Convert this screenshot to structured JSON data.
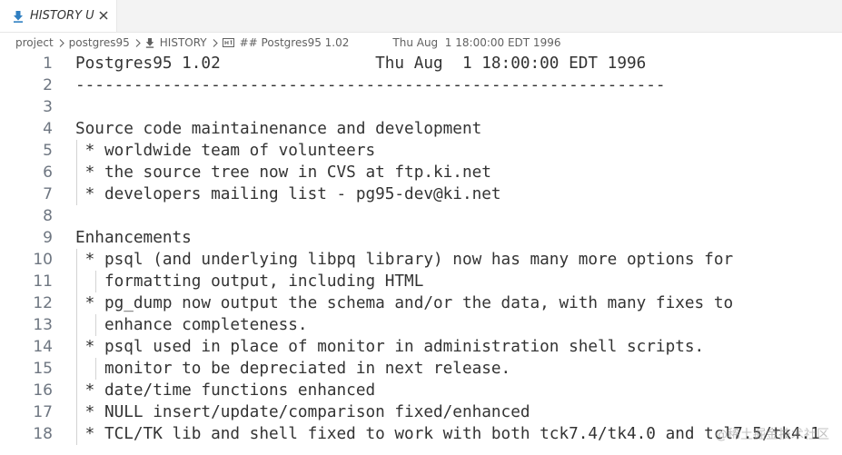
{
  "tab": {
    "label": "HISTORY U",
    "icon": "download-arrow-icon",
    "close_icon": "close-icon",
    "accent": "#2f7fc1"
  },
  "breadcrumb": {
    "items": [
      "project",
      "postgres95",
      "HISTORY",
      "## Postgres95 1.02"
    ],
    "trailing": "Thu Aug  1 18:00:00 EDT 1996"
  },
  "editor": {
    "line_numbers": [
      "1",
      "2",
      "3",
      "4",
      "5",
      "6",
      "7",
      "8",
      "9",
      "10",
      "11",
      "12",
      "13",
      "14",
      "15",
      "16",
      "17",
      "18"
    ],
    "lines": [
      "Postgres95 1.02                Thu Aug  1 18:00:00 EDT 1996",
      "-------------------------------------------------------------",
      "",
      "Source code maintainenance and development",
      " * worldwide team of volunteers",
      " * the source tree now in CVS at ftp.ki.net",
      " * developers mailing list - pg95-dev@ki.net",
      "",
      "Enhancements",
      " * psql (and underlying libpq library) now has many more options for",
      "   formatting output, including HTML",
      " * pg_dump now output the schema and/or the data, with many fixes to",
      "   enhance completeness.",
      " * psql used in place of monitor in administration shell scripts.",
      "   monitor to be depreciated in next release.",
      " * date/time functions enhanced",
      " * NULL insert/update/comparison fixed/enhanced",
      " * TCL/TK lib and shell fixed to work with both tck7.4/tk4.0 and tcl7.5/tk4.1"
    ]
  },
  "watermark": "@稀土掘金技术社区"
}
